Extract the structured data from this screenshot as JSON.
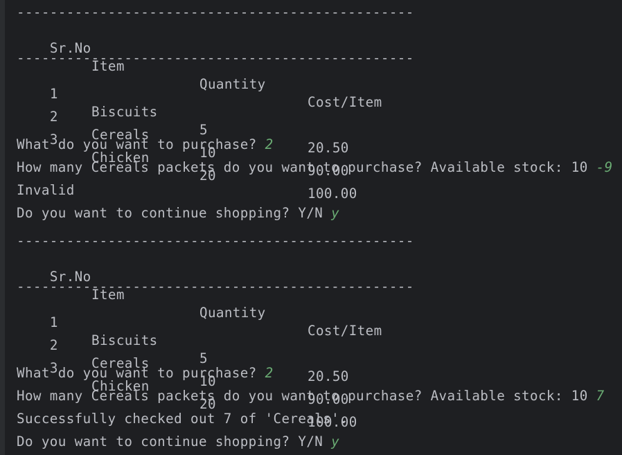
{
  "console": {
    "blocks": [
      {
        "separator": "------------------------------------------------",
        "header": [
          "Sr.No",
          "Item",
          "Quantity",
          "Cost/Item"
        ],
        "rows": [
          [
            "1",
            "Biscuits",
            "5",
            "20.50"
          ],
          [
            "2",
            "Cereals",
            "10",
            "90.00"
          ],
          [
            "3",
            "Chicken",
            "20",
            "100.00"
          ]
        ],
        "purchase_prompt": "What do you want to purchase? ",
        "purchase_input": "2",
        "quantity_prompt": "How many Cereals packets do you want to purchase? Available stock: 10 ",
        "quantity_input": "-9",
        "result": "Invalid",
        "continue_prompt": "Do you want to continue shopping? Y/N ",
        "continue_input": "y"
      },
      {
        "separator": "------------------------------------------------",
        "header": [
          "Sr.No",
          "Item",
          "Quantity",
          "Cost/Item"
        ],
        "rows": [
          [
            "1",
            "Biscuits",
            "5",
            "20.50"
          ],
          [
            "2",
            "Cereals",
            "10",
            "90.00"
          ],
          [
            "3",
            "Chicken",
            "20",
            "100.00"
          ]
        ],
        "purchase_prompt": "What do you want to purchase? ",
        "purchase_input": "2",
        "quantity_prompt": "How many Cereals packets do you want to purchase? Available stock: 10 ",
        "quantity_input": "7",
        "result": "Successfully checked out 7 of 'Cereals'.",
        "continue_prompt": "Do you want to continue shopping? Y/N ",
        "continue_input": "y"
      }
    ]
  },
  "colors": {
    "background": "#1e1f22",
    "text": "#bcbec4",
    "user_input": "#6aab73"
  }
}
